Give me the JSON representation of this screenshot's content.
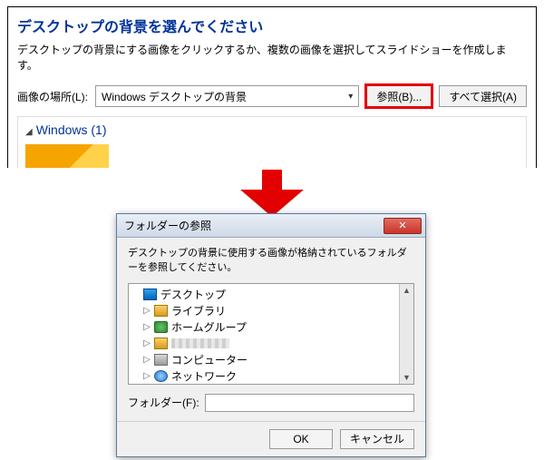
{
  "top": {
    "heading": "デスクトップの背景を選んでください",
    "subtext": "デスクトップの背景にする画像をクリックするか、複数の画像を選択してスライドショーを作成します。",
    "location_label": "画像の場所(L):",
    "location_value": "Windows デスクトップの背景",
    "browse_label": "参照(B)...",
    "select_all_label": "すべて選択(A)",
    "group_header": "Windows (1)"
  },
  "dialog": {
    "title": "フォルダーの参照",
    "message": "デスクトップの背景に使用する画像が格納されているフォルダーを参照してください。",
    "tree": [
      {
        "label": "デスクトップ",
        "icon": "desktop",
        "expandable": false,
        "indent": 0
      },
      {
        "label": "ライブラリ",
        "icon": "lib",
        "expandable": true,
        "indent": 1
      },
      {
        "label": "ホームグループ",
        "icon": "home",
        "expandable": true,
        "indent": 1
      },
      {
        "label": "",
        "icon": "user",
        "expandable": true,
        "indent": 1,
        "blurred": true
      },
      {
        "label": "コンピューター",
        "icon": "pc",
        "expandable": true,
        "indent": 1
      },
      {
        "label": "ネットワーク",
        "icon": "net",
        "expandable": true,
        "indent": 1
      }
    ],
    "folder_label": "フォルダー(F):",
    "folder_value": "",
    "ok_label": "OK",
    "cancel_label": "キャンセル"
  }
}
